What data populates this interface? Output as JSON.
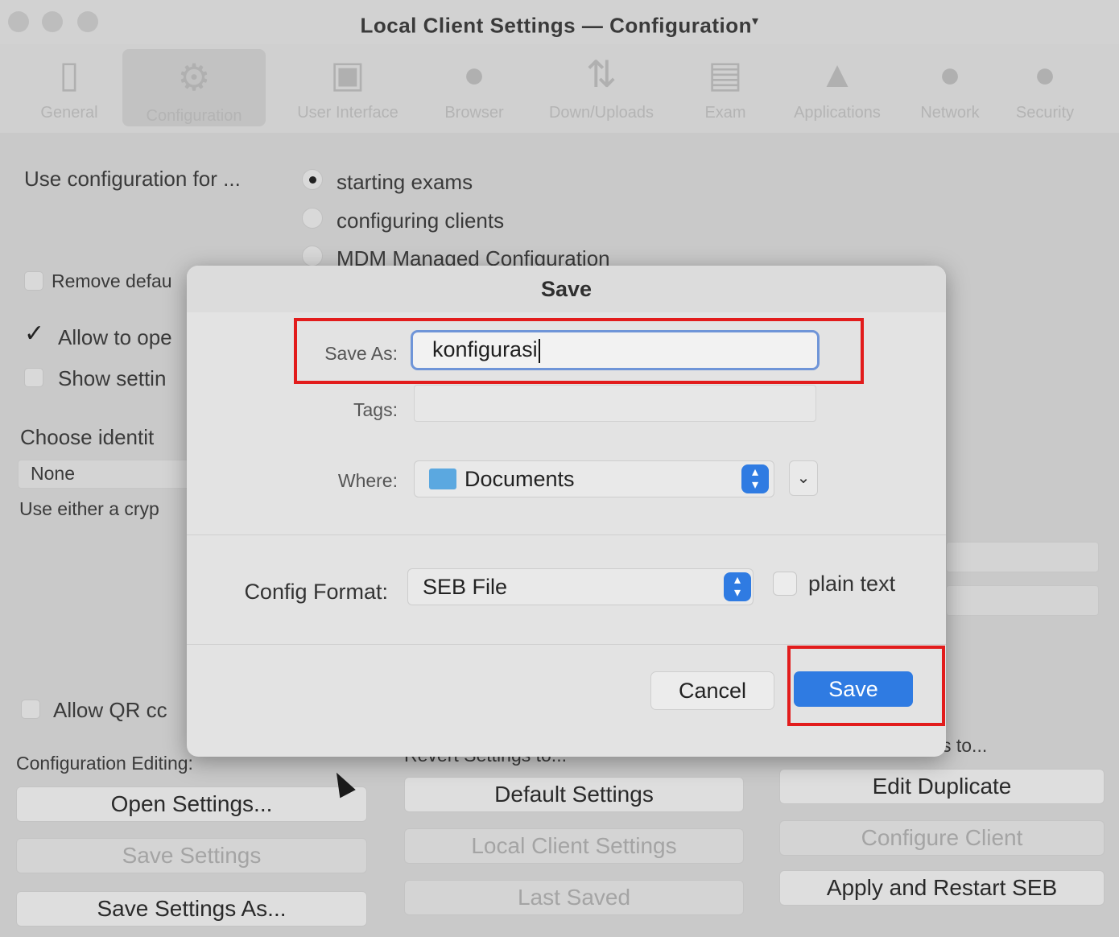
{
  "window": {
    "title": "Local Client Settings  —  Configuration",
    "title_marker": "▾"
  },
  "toolbar": {
    "items": [
      {
        "label": "General",
        "icon": "switch-icon"
      },
      {
        "label": "Configuration",
        "icon": "gears-icon",
        "selected": true
      },
      {
        "label": "User Interface",
        "icon": "window-icon"
      },
      {
        "label": "Browser",
        "icon": "globe-icon"
      },
      {
        "label": "Down/Uploads",
        "icon": "arrows-icon"
      },
      {
        "label": "Exam",
        "icon": "document-icon"
      },
      {
        "label": "Applications",
        "icon": "applications-icon"
      },
      {
        "label": "Network",
        "icon": "network-globe-icon"
      },
      {
        "label": "Security",
        "icon": "security-icon"
      }
    ]
  },
  "config": {
    "use_for_label": "Use configuration for ...",
    "options": [
      "starting exams",
      "configuring clients",
      "MDM Managed Configuration"
    ],
    "selected_option": 0,
    "remove_default": "Remove defau",
    "allow_open": "Allow to ope",
    "show_settings": "Show settin",
    "choose_identity": "Choose identit",
    "identity_value": "None",
    "use_either": "Use either a cryp",
    "allow_qr": "Allow QR cc"
  },
  "bottom": {
    "config_editing_label": "Configuration Editing:",
    "revert_label": "Revert Settings to...",
    "use_current_label": "Use Current Settings to...",
    "open_settings": "Open Settings...",
    "save_settings": "Save Settings",
    "save_settings_as": "Save Settings As...",
    "default_settings": "Default Settings",
    "local_client_settings": "Local Client Settings",
    "last_saved": "Last Saved",
    "edit_duplicate": "Edit Duplicate",
    "configure_client": "Configure Client",
    "apply_restart": "Apply and Restart SEB"
  },
  "dialog": {
    "title": "Save",
    "save_as_label": "Save As:",
    "save_as_value": "konfigurasi",
    "tags_label": "Tags:",
    "where_label": "Where:",
    "where_value": "Documents",
    "config_format_label": "Config Format:",
    "config_format_value": "SEB File",
    "plain_text_label": "plain text",
    "cancel_label": "Cancel",
    "save_label": "Save"
  },
  "colors": {
    "accent": "#2f7be2",
    "highlight": "#e21c1c"
  }
}
